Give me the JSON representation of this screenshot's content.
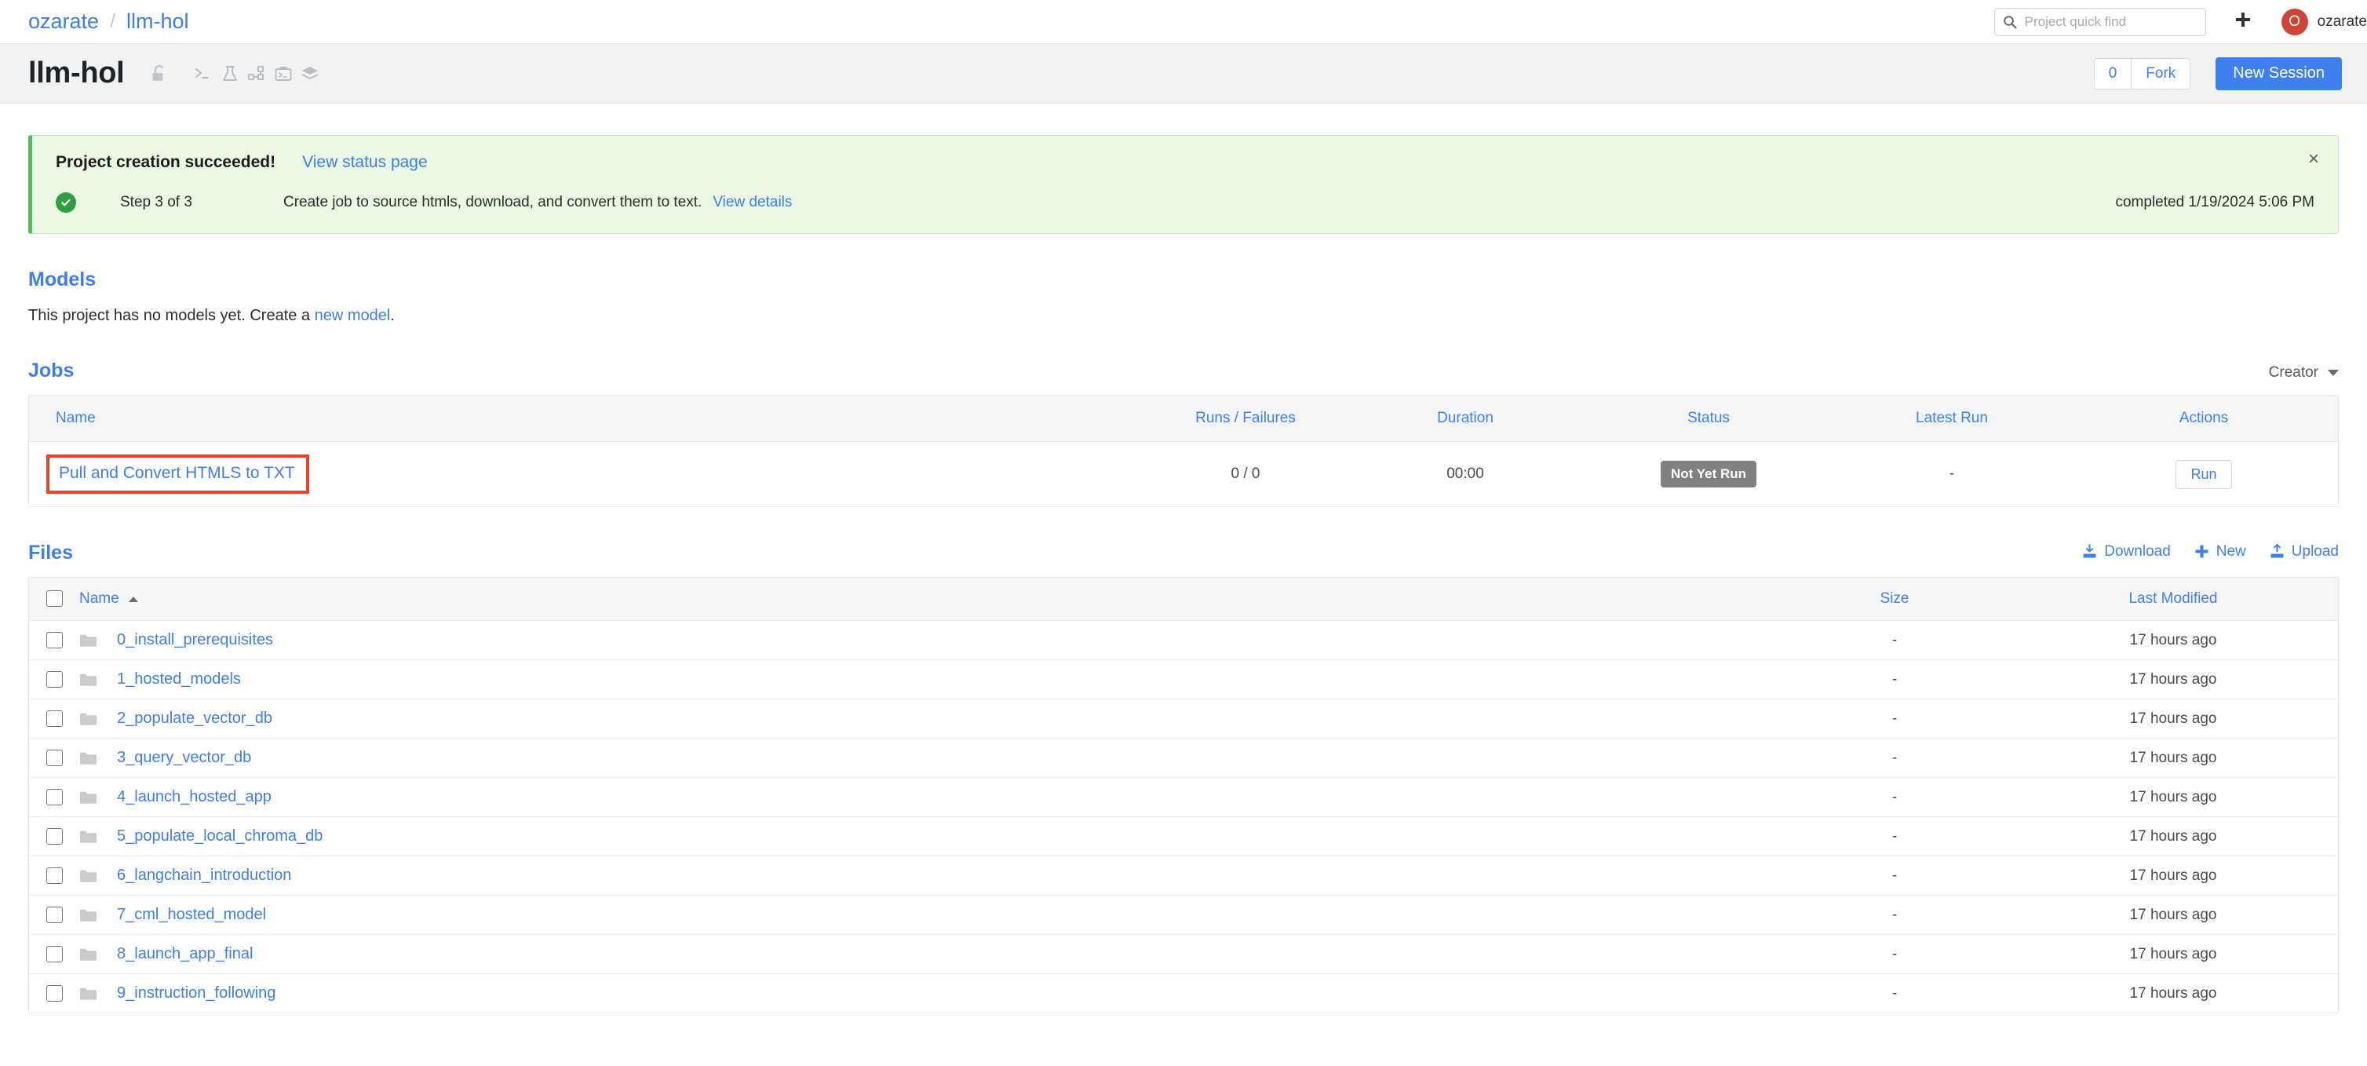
{
  "topnav": {
    "breadcrumb": {
      "owner": "ozarate",
      "separator": "/",
      "project": "llm-hol"
    },
    "search": {
      "placeholder": "Project quick find",
      "value": "",
      "icon": "search-icon"
    },
    "plus_icon": "plus-icon",
    "user": {
      "initial": "O",
      "name": "ozarate",
      "avatar_color": "#cf4436"
    }
  },
  "titlebar": {
    "project_name": "llm-hol",
    "icons": [
      "unlock-icon",
      "terminal-icon",
      "experiment-flask-icon",
      "model-graph-icon",
      "job-briefcase-icon",
      "layers-stack-icon"
    ],
    "fork_count": "0",
    "fork_label": "Fork",
    "new_session_label": "New Session",
    "primary_color": "#3f80ef"
  },
  "alert": {
    "title": "Project creation succeeded!",
    "link": "View status page",
    "close_label": "×",
    "status_icon": "check-circle-icon",
    "step": "Step 3 of 3",
    "description": "Create job to source htmls, download, and convert them to text.",
    "details_link": "View details",
    "completed": "completed 1/19/2024 5:06 PM",
    "accent_color": "#5cb85c"
  },
  "models": {
    "title": "Models",
    "empty_prefix": "This project has no models yet. Create a ",
    "empty_link": "new model",
    "empty_suffix": "."
  },
  "jobs": {
    "title": "Jobs",
    "creator_filter": "Creator",
    "columns": [
      "Name",
      "Runs / Failures",
      "Duration",
      "Status",
      "Latest Run",
      "Actions"
    ],
    "rows": [
      {
        "name": "Pull and Convert HTMLS to TXT",
        "runs_failures": "0 / 0",
        "duration": "00:00",
        "status": "Not Yet Run",
        "latest_run": "-",
        "action": "Run",
        "highlighted": true,
        "highlight_color": "#e8432a"
      }
    ]
  },
  "files": {
    "title": "Files",
    "actions": [
      {
        "label": "Download",
        "icon": "download-icon"
      },
      {
        "label": "New",
        "icon": "plus-icon"
      },
      {
        "label": "Upload",
        "icon": "upload-icon"
      }
    ],
    "columns": [
      "Name",
      "Size",
      "Last Modified"
    ],
    "sort": {
      "column": "Name",
      "direction": "asc"
    },
    "rows": [
      {
        "name": "0_install_prerequisites",
        "size": "-",
        "modified": "17 hours ago",
        "icon": "folder-icon"
      },
      {
        "name": "1_hosted_models",
        "size": "-",
        "modified": "17 hours ago",
        "icon": "folder-icon"
      },
      {
        "name": "2_populate_vector_db",
        "size": "-",
        "modified": "17 hours ago",
        "icon": "folder-icon"
      },
      {
        "name": "3_query_vector_db",
        "size": "-",
        "modified": "17 hours ago",
        "icon": "folder-icon"
      },
      {
        "name": "4_launch_hosted_app",
        "size": "-",
        "modified": "17 hours ago",
        "icon": "folder-icon"
      },
      {
        "name": "5_populate_local_chroma_db",
        "size": "-",
        "modified": "17 hours ago",
        "icon": "folder-icon"
      },
      {
        "name": "6_langchain_introduction",
        "size": "-",
        "modified": "17 hours ago",
        "icon": "folder-icon"
      },
      {
        "name": "7_cml_hosted_model",
        "size": "-",
        "modified": "17 hours ago",
        "icon": "folder-icon"
      },
      {
        "name": "8_launch_app_final",
        "size": "-",
        "modified": "17 hours ago",
        "icon": "folder-icon"
      },
      {
        "name": "9_instruction_following",
        "size": "-",
        "modified": "17 hours ago",
        "icon": "folder-icon"
      }
    ]
  }
}
